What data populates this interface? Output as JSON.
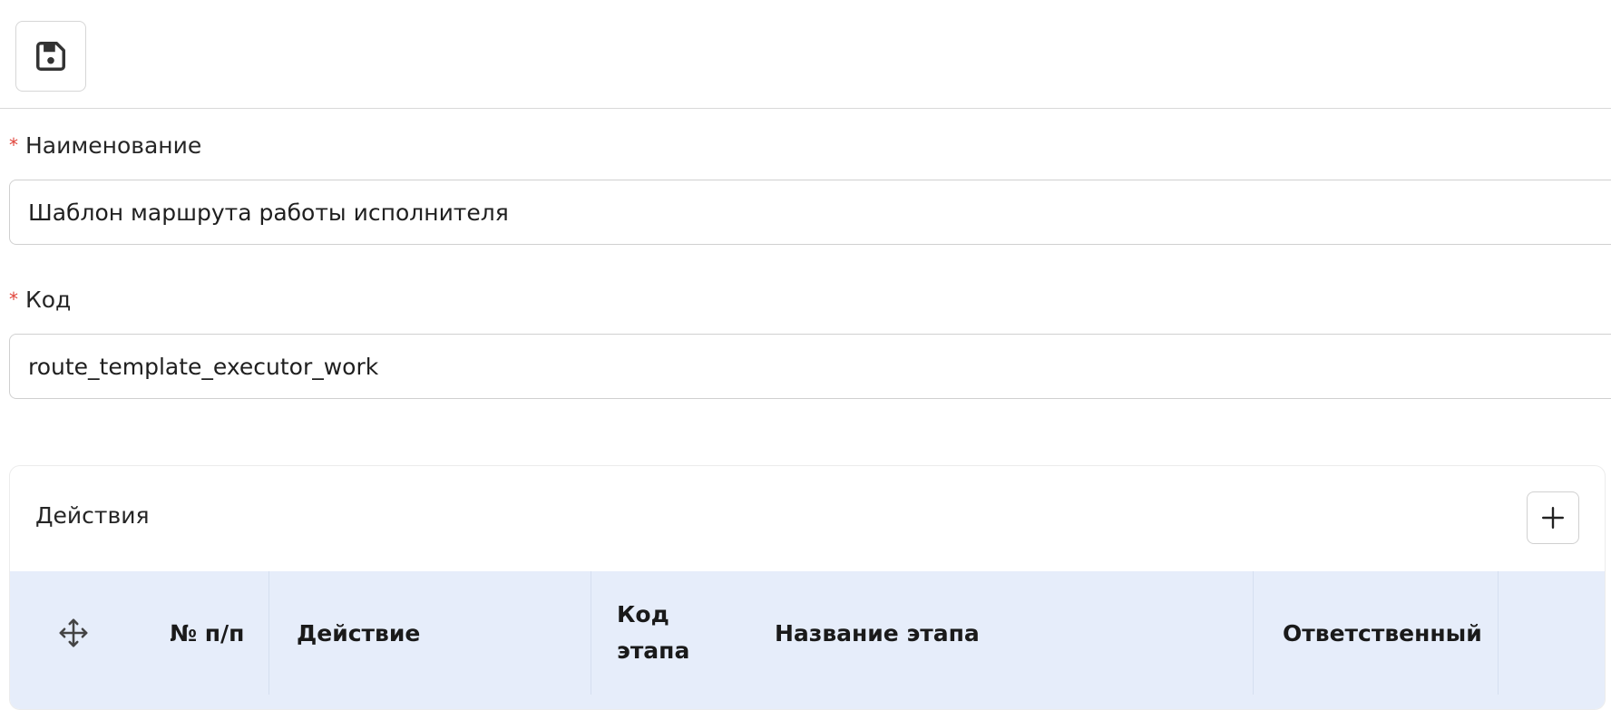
{
  "toolbar": {
    "save_icon": "floppy-disk-save-icon"
  },
  "form": {
    "name_field": {
      "required_mark": "*",
      "label": "Наименование",
      "value": "Шаблон маршрута работы исполнителя"
    },
    "code_field": {
      "required_mark": "*",
      "label": "Код",
      "value": "route_template_executor_work"
    }
  },
  "actions_section": {
    "title": "Действия",
    "add_icon": "plus-icon",
    "table": {
      "move_icon": "move-arrows-icon",
      "columns": [
        "№ п/п",
        "Действие",
        "Код этапа",
        "Название этапа",
        "Ответственный"
      ]
    }
  },
  "colors": {
    "required": "#e0443a",
    "table_header_bg": "#e6edfa",
    "border": "#d0d0d0"
  }
}
